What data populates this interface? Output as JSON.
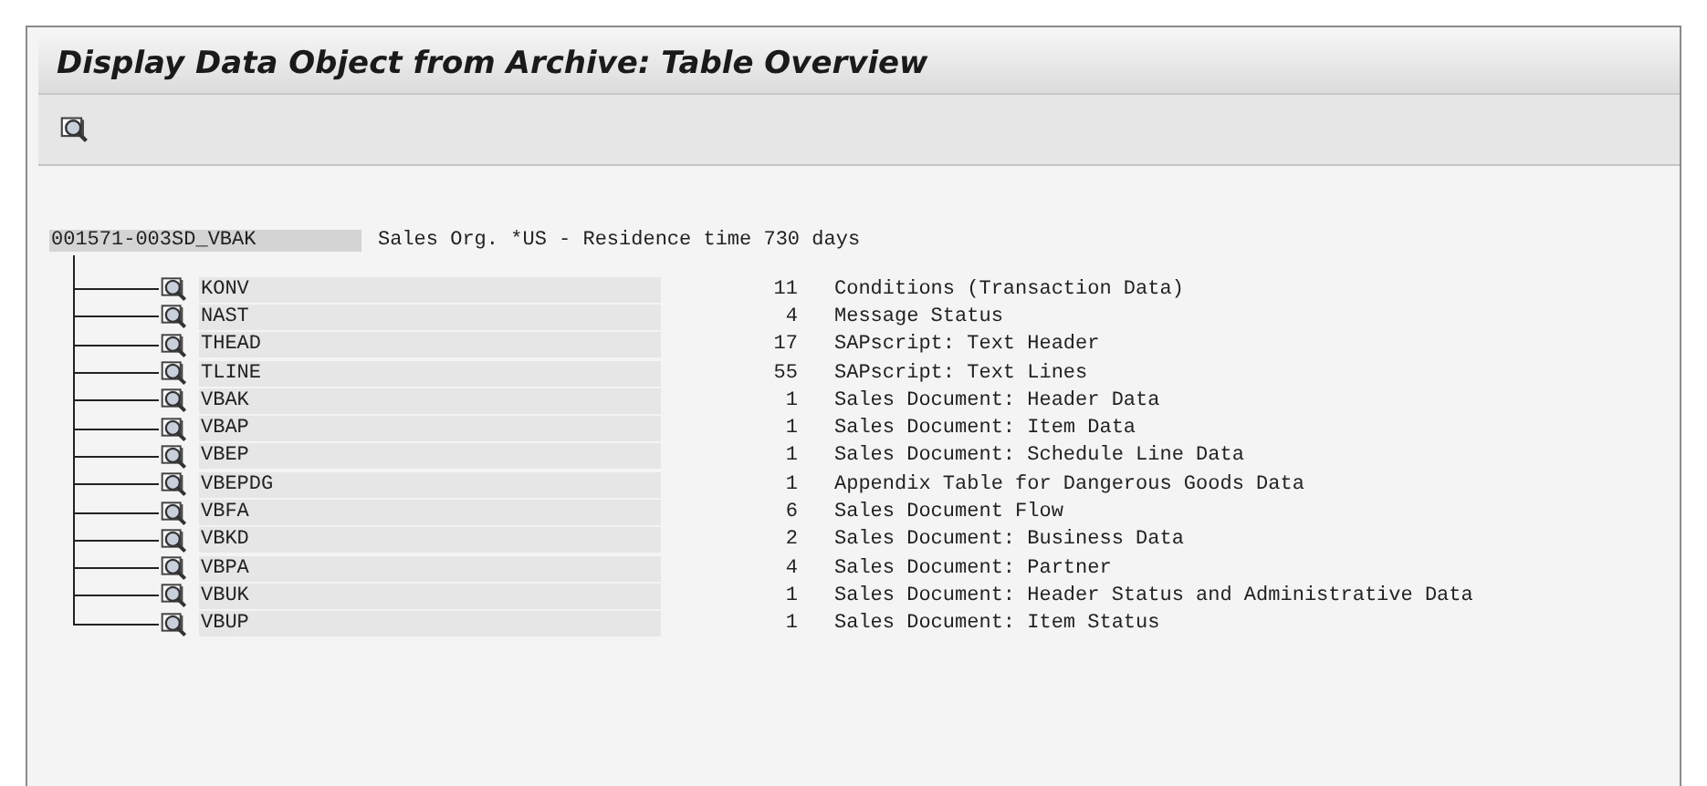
{
  "window": {
    "title": "Display Data Object from Archive: Table Overview"
  },
  "root": {
    "name": "001571-003SD_VBAK",
    "description": "Sales Org. *US - Residence time 730 days"
  },
  "tables": [
    {
      "name": "KONV",
      "count": "11",
      "description": "Conditions (Transaction Data)"
    },
    {
      "name": "NAST",
      "count": "4",
      "description": "Message Status"
    },
    {
      "name": "THEAD",
      "count": "17",
      "description": "SAPscript: Text Header"
    },
    {
      "name": "TLINE",
      "count": "55",
      "description": "SAPscript: Text Lines"
    },
    {
      "name": "VBAK",
      "count": "1",
      "description": "Sales Document: Header Data"
    },
    {
      "name": "VBAP",
      "count": "1",
      "description": "Sales Document: Item Data"
    },
    {
      "name": "VBEP",
      "count": "1",
      "description": "Sales Document: Schedule Line Data"
    },
    {
      "name": "VBEPDG",
      "count": "1",
      "description": "Appendix Table for Dangerous Goods Data"
    },
    {
      "name": "VBFA",
      "count": "6",
      "description": "Sales Document Flow"
    },
    {
      "name": "VBKD",
      "count": "2",
      "description": "Sales Document: Business Data"
    },
    {
      "name": "VBPA",
      "count": "4",
      "description": "Sales Document: Partner"
    },
    {
      "name": "VBUK",
      "count": "1",
      "description": "Sales Document: Header Status and Administrative Data"
    },
    {
      "name": "VBUP",
      "count": "1",
      "description": "Sales Document: Item Status"
    }
  ]
}
